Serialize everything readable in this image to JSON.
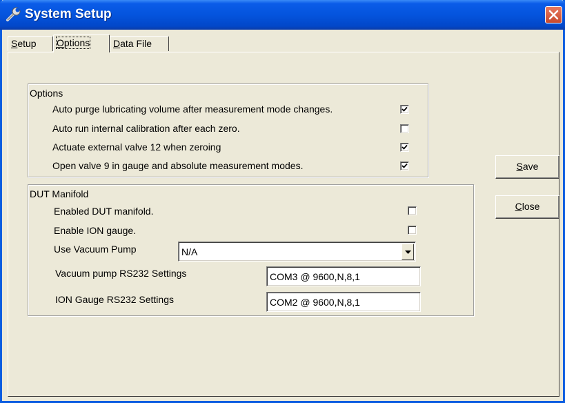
{
  "window": {
    "title": "System Setup"
  },
  "tabs": [
    {
      "accel": "S",
      "rest": "etup"
    },
    {
      "accel": "O",
      "rest": "ptions"
    },
    {
      "accel": "D",
      "rest": "ata File"
    }
  ],
  "options": {
    "title": "Options",
    "items": [
      {
        "label": "Auto purge lubricating volume after measurement mode changes.",
        "checked": true
      },
      {
        "label": "Auto run internal calibration after each zero.",
        "checked": false
      },
      {
        "label": "Actuate external valve 12 when zeroing",
        "checked": true
      },
      {
        "label": "Open valve 9 in gauge and absolute measurement modes.",
        "checked": true
      }
    ]
  },
  "dut": {
    "title": "DUT Manifold",
    "enabled_label": "Enabled DUT manifold.",
    "enabled_checked": false,
    "ion_label": "Enable ION gauge.",
    "ion_checked": false,
    "pump_label": "Use Vacuum Pump",
    "pump_value": "N/A",
    "vac_rs232_label": "Vacuum pump RS232 Settings",
    "vac_rs232_value": "COM3 @ 9600,N,8,1",
    "ion_rs232_label": "ION Gauge RS232 Settings",
    "ion_rs232_value": "COM2 @ 9600,N,8,1"
  },
  "buttons": {
    "save": {
      "accel": "S",
      "rest": "ave"
    },
    "close": {
      "accel": "C",
      "rest": "lose"
    }
  },
  "icons": {
    "title": "wrench-icon",
    "close": "close-icon",
    "check": "checkmark-icon",
    "dropdown": "dropdown-arrow-icon"
  },
  "colors": {
    "titlebar": "#0454dd",
    "close_button": "#c8492c",
    "dialog_bg": "#ece9d8"
  }
}
